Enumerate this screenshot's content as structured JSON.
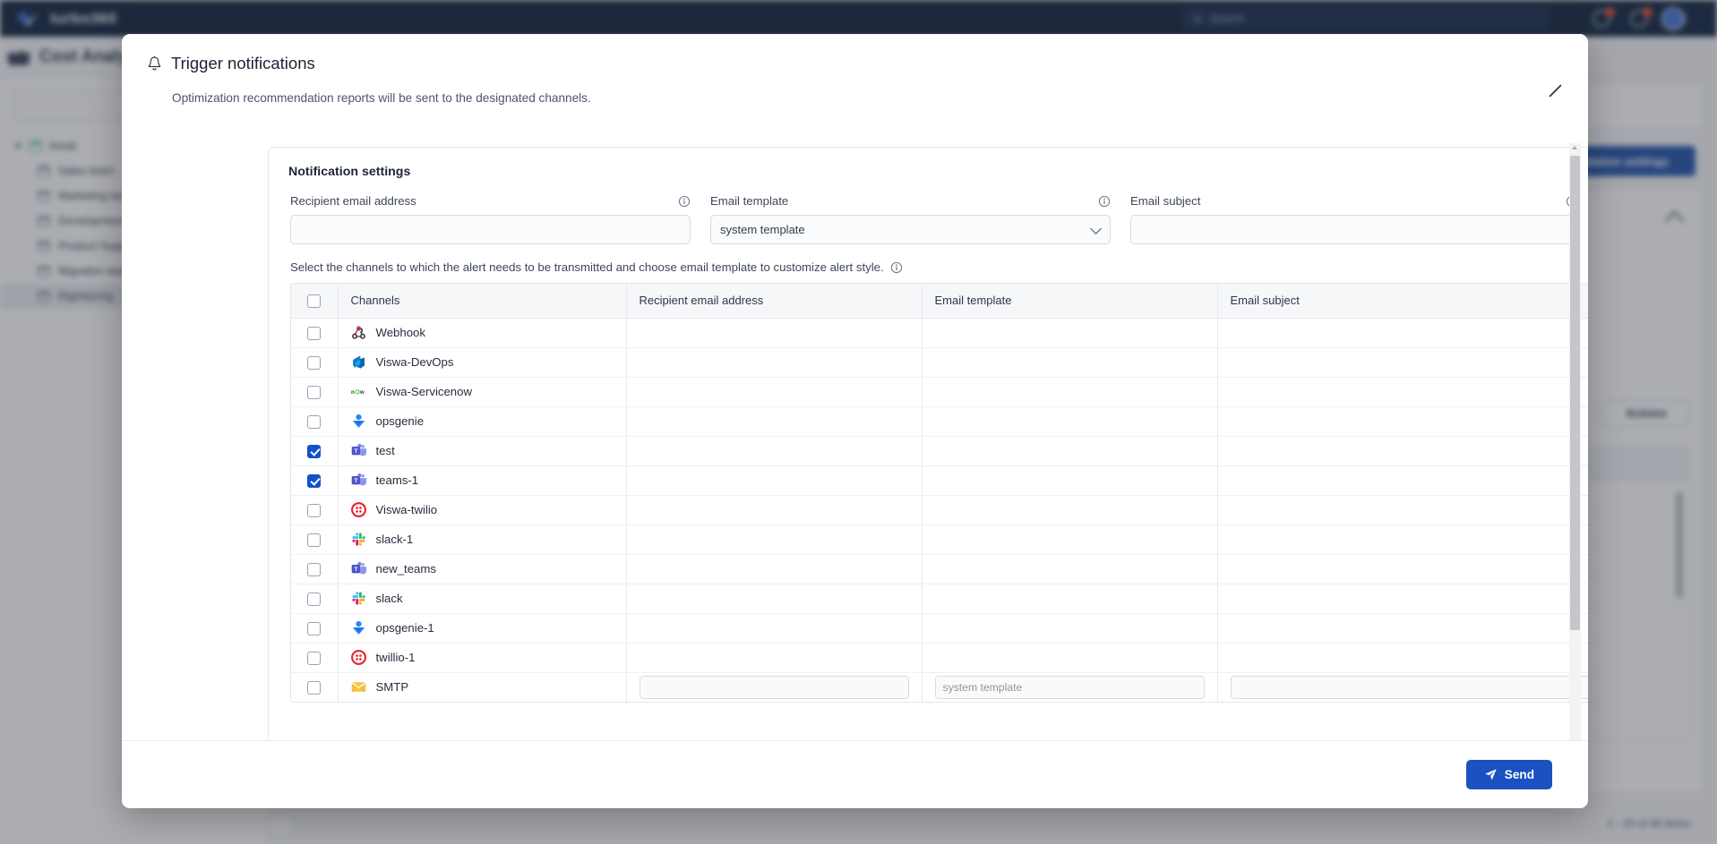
{
  "background": {
    "brand": "turbo360",
    "search_placeholder": "Search",
    "page_title": "Cost Analyzer",
    "recommendation_button": "Recommendation settings",
    "actions_button": "Actions",
    "pager_text": "1 - 20 of 40 items",
    "tree": [
      {
        "label": "kovai",
        "level": 0,
        "selected": false
      },
      {
        "label": "Sales team",
        "level": 1,
        "selected": false
      },
      {
        "label": "Marketing team",
        "level": 1,
        "selected": false
      },
      {
        "label": "Development team",
        "level": 1,
        "selected": false
      },
      {
        "label": "Product Support",
        "level": 1,
        "selected": false
      },
      {
        "label": "Migration team",
        "level": 1,
        "selected": false
      },
      {
        "label": "Rightsizing",
        "level": 1,
        "selected": true
      }
    ]
  },
  "modal": {
    "title": "Trigger notifications",
    "subtitle": "Optimization recommendation reports will be sent to the designated channels.",
    "close_label": "Close",
    "settings_title": "Notification settings",
    "hint": "Select the channels to which the alert needs to be transmitted and choose email template to customize alert style.",
    "fields": {
      "recipient": {
        "label": "Recipient email address",
        "value": "",
        "placeholder": ""
      },
      "template": {
        "label": "Email template",
        "value": "system template",
        "options": [
          "system template"
        ]
      },
      "subject": {
        "label": "Email subject",
        "value": "",
        "placeholder": ""
      }
    },
    "table": {
      "columns": [
        "Channels",
        "Recipient email address",
        "Email template",
        "Email subject"
      ],
      "header_checked": false,
      "rows": [
        {
          "name": "Webhook",
          "icon": "webhook-icon",
          "checked": false,
          "has_inputs": false
        },
        {
          "name": "Viswa-DevOps",
          "icon": "azure-devops-icon",
          "checked": false,
          "has_inputs": false
        },
        {
          "name": "Viswa-Servicenow",
          "icon": "servicenow-icon",
          "checked": false,
          "has_inputs": false
        },
        {
          "name": "opsgenie",
          "icon": "opsgenie-icon",
          "checked": false,
          "has_inputs": false
        },
        {
          "name": "test",
          "icon": "teams-icon",
          "checked": true,
          "has_inputs": false
        },
        {
          "name": "teams-1",
          "icon": "teams-icon",
          "checked": true,
          "has_inputs": false
        },
        {
          "name": "Viswa-twilio",
          "icon": "twilio-icon",
          "checked": false,
          "has_inputs": false
        },
        {
          "name": "slack-1",
          "icon": "slack-icon",
          "checked": false,
          "has_inputs": false
        },
        {
          "name": "new_teams",
          "icon": "teams-icon",
          "checked": false,
          "has_inputs": false
        },
        {
          "name": "slack",
          "icon": "slack-icon",
          "checked": false,
          "has_inputs": false
        },
        {
          "name": "opsgenie-1",
          "icon": "opsgenie-icon",
          "checked": false,
          "has_inputs": false
        },
        {
          "name": "twillio-1",
          "icon": "twilio-icon",
          "checked": false,
          "has_inputs": false
        },
        {
          "name": "SMTP",
          "icon": "smtp-mail-icon",
          "checked": false,
          "has_inputs": true,
          "recipient_value": "",
          "template_placeholder": "system template",
          "subject_value": ""
        }
      ]
    },
    "send_button": "Send"
  },
  "colors": {
    "primary": "#1b51c0",
    "topbar": "#0b1d39",
    "checkbox_checked": "#1351c8"
  }
}
